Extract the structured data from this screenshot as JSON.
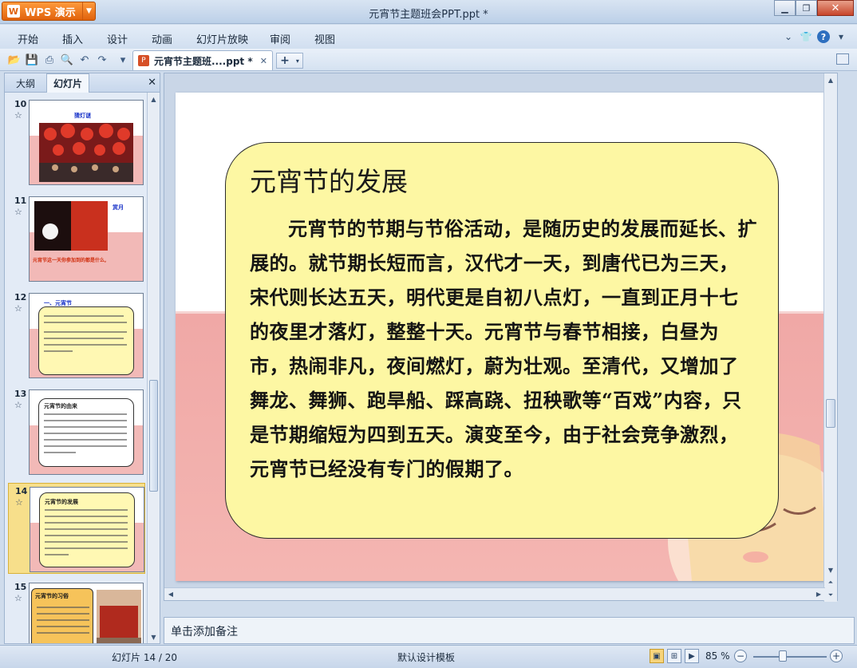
{
  "app": {
    "button_label": "WPS 演示",
    "logo_glyph": "W"
  },
  "window": {
    "title": "元宵节主题班会PPT.ppt *"
  },
  "menu": [
    "开始",
    "插入",
    "设计",
    "动画",
    "幻灯片放映",
    "审阅",
    "视图"
  ],
  "document_tab": {
    "label": "元宵节主题班....ppt *",
    "close": "✕"
  },
  "left_panel": {
    "tabs": [
      "大纲",
      "幻灯片"
    ],
    "active_tab": "幻灯片",
    "close": "✕",
    "thumbnails": [
      {
        "number": "10",
        "title": "猜灯谜",
        "star": "☆",
        "selected": false
      },
      {
        "number": "11",
        "title": "赏月",
        "caption": "元宵节这一天你参加到的都是什么,",
        "star": "☆",
        "selected": false
      },
      {
        "number": "12",
        "title": "一、元宵节",
        "star": "☆",
        "selected": false
      },
      {
        "number": "13",
        "title": "元宵节的由来",
        "star": "☆",
        "selected": false
      },
      {
        "number": "14",
        "title": "元宵节的发展",
        "star": "☆",
        "selected": true
      },
      {
        "number": "15",
        "title": "元宵节的习俗",
        "star": "☆",
        "selected": false
      }
    ]
  },
  "slide": {
    "title": "元宵节的发展",
    "body": "元宵节的节期与节俗活动，是随历史的发展而延长、扩展的。就节期长短而言，汉代才一天，到唐代已为三天，宋代则长达五天，明代更是自初八点灯，一直到正月十七的夜里才落灯，整整十天。元宵节与春节相接，白昼为市，热闹非凡，夜间燃灯，蔚为壮观。至清代，又增加了舞龙、舞狮、跑旱船、踩高跷、扭秧歌等“百戏”内容，只是节期缩短为四到五天。演变至今，由于社会竞争激烈，元宵节已经没有专门的假期了。"
  },
  "notes": {
    "placeholder": "单击添加备注"
  },
  "status": {
    "slide_counter": "幻灯片 14 / 20",
    "template": "默认设计模板",
    "zoom": "85 %",
    "zoom_fraction": 0.4
  },
  "colors": {
    "accent": "#e0620c",
    "textbox_fill": "#fdf7a3",
    "slide_band": "#f0a8a6"
  }
}
